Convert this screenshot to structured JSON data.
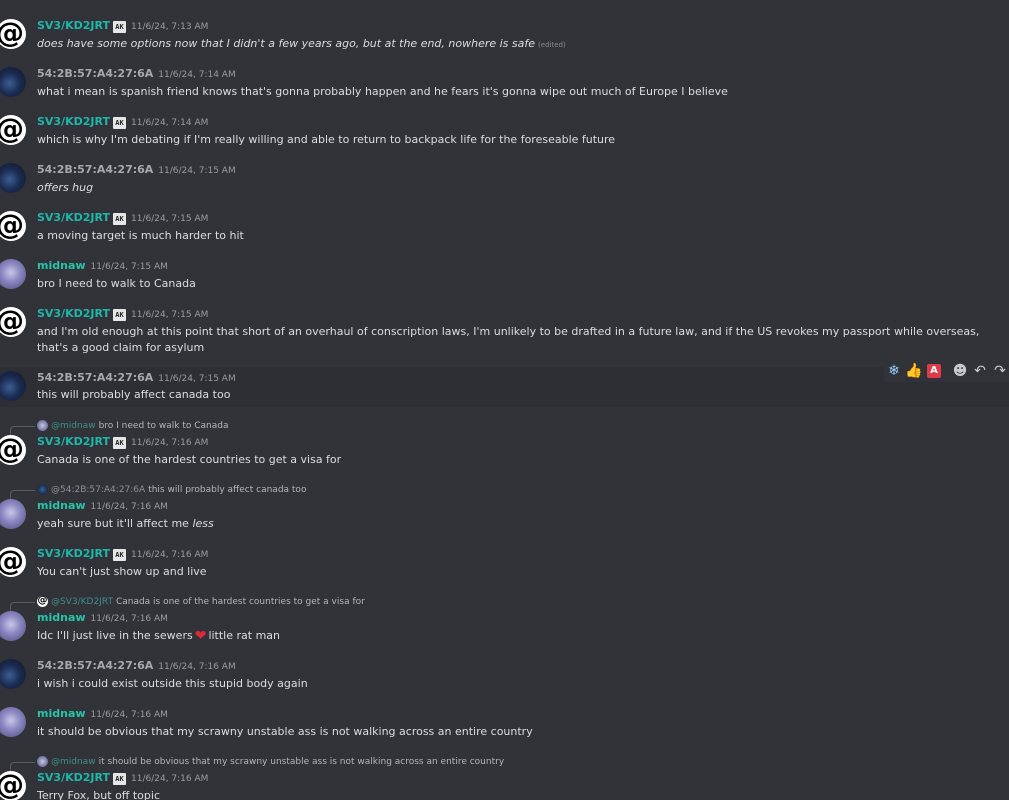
{
  "users": {
    "sv3": {
      "name": "SV3/KD2JRT",
      "badge": "AK"
    },
    "mac": {
      "name": "54:2B:57:A4:27:6A"
    },
    "mid": {
      "name": "midnaw"
    }
  },
  "messages": [
    {
      "author": "SV3/KD2JRT",
      "time": "11/6/24, 7:13 AM",
      "text": "does have some options now that I didn't a few years ago, but at the end, nowhere is safe",
      "edited": "(edited)"
    },
    {
      "author": "54:2B:57:A4:27:6A",
      "time": "11/6/24, 7:14 AM",
      "text": "what i mean is spanish friend knows that's gonna probably happen and he fears it's gonna wipe out much of Europe I believe"
    },
    {
      "author": "SV3/KD2JRT",
      "time": "11/6/24, 7:14 AM",
      "text": "which is why I'm debating if I'm really willing and able to return to backpack life for the foreseable future"
    },
    {
      "author": "54:2B:57:A4:27:6A",
      "time": "11/6/24, 7:15 AM",
      "text": "offers hug"
    },
    {
      "author": "SV3/KD2JRT",
      "time": "11/6/24, 7:15 AM",
      "text": "a moving target is much harder to hit"
    },
    {
      "author": "midnaw",
      "time": "11/6/24, 7:15 AM",
      "text": "bro I need to walk to Canada"
    },
    {
      "author": "SV3/KD2JRT",
      "time": "11/6/24, 7:15 AM",
      "text": "and I'm old enough at this point that short of an overhaul of conscription laws, I'm unlikely to be drafted in a future law, and if the US revokes my passport while overseas, that's a good claim for asylum"
    },
    {
      "author": "54:2B:57:A4:27:6A",
      "time": "11/6/24, 7:15 AM",
      "text": "this will probably affect canada too"
    },
    {
      "author": "SV3/KD2JRT",
      "time": "11/6/24, 7:16 AM",
      "text": "Canada is one of the hardest countries to get a visa for",
      "reply": {
        "name": "@midnaw",
        "text": "bro I need to walk to Canada"
      }
    },
    {
      "author": "midnaw",
      "time": "11/6/24, 7:16 AM",
      "text_before": "yeah sure but it'll affect me ",
      "text_emph": "less",
      "reply": {
        "name": "@54:2B:57:A4:27:6A",
        "text": "this will probably affect canada too"
      }
    },
    {
      "author": "SV3/KD2JRT",
      "time": "11/6/24, 7:16 AM",
      "text": "You can't just show up and live"
    },
    {
      "author": "midnaw",
      "time": "11/6/24, 7:16 AM",
      "text_before": "Idc I'll just live in the sewers",
      "emoji": "❤",
      "text_after": "little rat man",
      "reply": {
        "name": "@SV3/KD2JRT",
        "text": "Canada is one of the hardest countries to get a visa for"
      }
    },
    {
      "author": "54:2B:57:A4:27:6A",
      "time": "11/6/24, 7:16 AM",
      "text": "i wish i could exist outside this stupid body again"
    },
    {
      "author": "midnaw",
      "time": "11/6/24, 7:16 AM",
      "text": "it should be obvious that my scrawny unstable ass is not walking across an entire country"
    },
    {
      "author": "SV3/KD2JRT",
      "time": "11/6/24, 7:16 AM",
      "text": "Terry Fox, but off topic",
      "reply": {
        "name": "@midnaw",
        "text": "it should be obvious that my scrawny unstable ass is not walking across an entire country"
      }
    }
  ],
  "toolbar": {
    "icons": [
      "snowflake-reaction-icon",
      "thumbs-up-reaction-icon",
      "a-letter-reaction-icon",
      "add-reaction-icon",
      "reply-icon",
      "forward-icon"
    ],
    "a_letter": "A"
  },
  "colors": {
    "background": "#323339",
    "sv3_name": "#1fb7a9",
    "mac_name": "#a7a8ad",
    "mid_name": "#27c3a7",
    "text": "#dcdde0",
    "timestamp": "#9a9ba2",
    "heart": "#e0283a"
  }
}
